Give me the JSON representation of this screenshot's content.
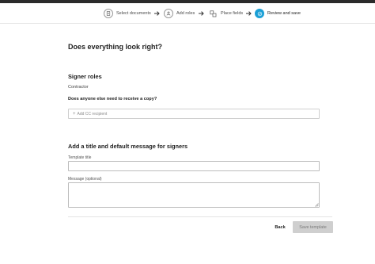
{
  "stepper": {
    "steps": [
      {
        "label": "Select documents",
        "icon": "document-icon",
        "active": false
      },
      {
        "label": "Add roles",
        "icon": "person-icon",
        "active": false
      },
      {
        "label": "Place fields",
        "icon": "fields-icon",
        "active": false
      },
      {
        "label": "Review and save",
        "icon": "check-icon",
        "active": true
      }
    ]
  },
  "main": {
    "title": "Does everything look right?",
    "signer_roles": {
      "heading": "Signer roles",
      "roles": [
        "Contractor"
      ]
    },
    "cc": {
      "question": "Does anyone else need to receive a copy?",
      "add_label": "Add CC recipient"
    },
    "message_section": {
      "heading": "Add a title and default message for signers",
      "template_title_label": "Template title",
      "template_title_value": "",
      "message_label": "Message (optional)",
      "message_value": ""
    }
  },
  "footer": {
    "back_label": "Back",
    "save_label": "Save template"
  },
  "colors": {
    "accent": "#1a9fd6",
    "disabled_button": "#cfcfcf"
  }
}
